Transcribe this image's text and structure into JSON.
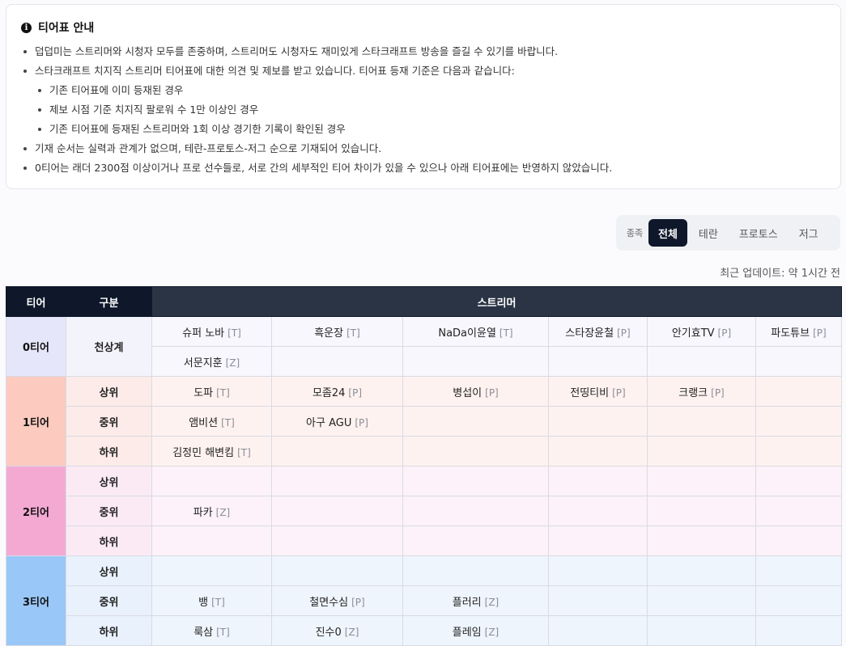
{
  "notice": {
    "title": "티어표 안내",
    "items": [
      {
        "text": "덥덥미는 스트리머와 시청자 모두를 존중하며, 스트리머도 시청자도 재미있게 스타크래프트 방송을 즐길 수 있기를 바랍니다.",
        "level": 0
      },
      {
        "text": "스타크래프트 치지직 스트리머 티어표에 대한 의견 및 제보를 받고 있습니다. 티어표 등재 기준은 다음과 같습니다:",
        "level": 0
      },
      {
        "text": "기존 티어표에 이미 등재된 경우",
        "level": 1
      },
      {
        "text": "제보 시점 기준 치지직 팔로워 수 1만 이상인 경우",
        "level": 1
      },
      {
        "text": "기존 티어표에 등재된 스트리머와 1회 이상 경기한 기록이 확인된 경우",
        "level": 1
      },
      {
        "text": "기재 순서는 실력과 관계가 없으며, 테란-프로토스-저그 순으로 기재되어 있습니다.",
        "level": 0
      },
      {
        "text": "0티어는 래더 2300점 이상이거나 프로 선수들로, 서로 간의 세부적인 티어 차이가 있을 수 있으나 아래 티어표에는 반영하지 않았습니다.",
        "level": 0
      }
    ]
  },
  "filter": {
    "label": "종족",
    "options": [
      "전체",
      "테란",
      "프로토스",
      "저그"
    ],
    "selected": "전체"
  },
  "updated": "최근 업데이트: 약 1시간 전",
  "table": {
    "headers": [
      "티어",
      "구분",
      "스트리머"
    ],
    "tiers": [
      {
        "name": "0티어",
        "rows": [
          {
            "sub": "천상계",
            "cells": [
              {
                "name": "슈퍼 노바",
                "race": "[T]"
              },
              {
                "name": "흑운장",
                "race": "[T]"
              },
              {
                "name": "NaDa이윤열",
                "race": "[T]"
              },
              {
                "name": "스타장윤철",
                "race": "[P]"
              },
              {
                "name": "안기효TV",
                "race": "[P]"
              },
              {
                "name": "파도튜브",
                "race": "[P]"
              }
            ]
          },
          {
            "sub": "",
            "cells": [
              {
                "name": "서문지훈",
                "race": "[Z]"
              },
              {
                "name": "",
                "race": ""
              },
              {
                "name": "",
                "race": ""
              },
              {
                "name": "",
                "race": ""
              },
              {
                "name": "",
                "race": ""
              },
              {
                "name": "",
                "race": ""
              }
            ]
          }
        ]
      },
      {
        "name": "1티어",
        "rows": [
          {
            "sub": "상위",
            "cells": [
              {
                "name": "도파",
                "race": "[T]"
              },
              {
                "name": "모좀24",
                "race": "[P]"
              },
              {
                "name": "병섭이",
                "race": "[P]"
              },
              {
                "name": "전띵티비",
                "race": "[P]"
              },
              {
                "name": "크랭크",
                "race": "[P]"
              },
              {
                "name": "",
                "race": ""
              }
            ]
          },
          {
            "sub": "중위",
            "cells": [
              {
                "name": "앰비션",
                "race": "[T]"
              },
              {
                "name": "아구 AGU",
                "race": "[P]"
              },
              {
                "name": "",
                "race": ""
              },
              {
                "name": "",
                "race": ""
              },
              {
                "name": "",
                "race": ""
              },
              {
                "name": "",
                "race": ""
              }
            ]
          },
          {
            "sub": "하위",
            "cells": [
              {
                "name": "김정민 해변킴",
                "race": "[T]"
              },
              {
                "name": "",
                "race": ""
              },
              {
                "name": "",
                "race": ""
              },
              {
                "name": "",
                "race": ""
              },
              {
                "name": "",
                "race": ""
              },
              {
                "name": "",
                "race": ""
              }
            ]
          }
        ]
      },
      {
        "name": "2티어",
        "rows": [
          {
            "sub": "상위",
            "cells": [
              {
                "name": "",
                "race": ""
              },
              {
                "name": "",
                "race": ""
              },
              {
                "name": "",
                "race": ""
              },
              {
                "name": "",
                "race": ""
              },
              {
                "name": "",
                "race": ""
              },
              {
                "name": "",
                "race": ""
              }
            ]
          },
          {
            "sub": "중위",
            "cells": [
              {
                "name": "파카",
                "race": "[Z]"
              },
              {
                "name": "",
                "race": ""
              },
              {
                "name": "",
                "race": ""
              },
              {
                "name": "",
                "race": ""
              },
              {
                "name": "",
                "race": ""
              },
              {
                "name": "",
                "race": ""
              }
            ]
          },
          {
            "sub": "하위",
            "cells": [
              {
                "name": "",
                "race": ""
              },
              {
                "name": "",
                "race": ""
              },
              {
                "name": "",
                "race": ""
              },
              {
                "name": "",
                "race": ""
              },
              {
                "name": "",
                "race": ""
              },
              {
                "name": "",
                "race": ""
              }
            ]
          }
        ]
      },
      {
        "name": "3티어",
        "rows": [
          {
            "sub": "상위",
            "cells": [
              {
                "name": "",
                "race": ""
              },
              {
                "name": "",
                "race": ""
              },
              {
                "name": "",
                "race": ""
              },
              {
                "name": "",
                "race": ""
              },
              {
                "name": "",
                "race": ""
              },
              {
                "name": "",
                "race": ""
              }
            ]
          },
          {
            "sub": "중위",
            "cells": [
              {
                "name": "뱅",
                "race": "[T]"
              },
              {
                "name": "철면수심",
                "race": "[P]"
              },
              {
                "name": "플러리",
                "race": "[Z]"
              },
              {
                "name": "",
                "race": ""
              },
              {
                "name": "",
                "race": ""
              },
              {
                "name": "",
                "race": ""
              }
            ]
          },
          {
            "sub": "하위",
            "cells": [
              {
                "name": "룩삼",
                "race": "[T]"
              },
              {
                "name": "진수0",
                "race": "[Z]"
              },
              {
                "name": "플레임",
                "race": "[Z]"
              },
              {
                "name": "",
                "race": ""
              },
              {
                "name": "",
                "race": ""
              },
              {
                "name": "",
                "race": ""
              }
            ]
          }
        ]
      }
    ]
  }
}
